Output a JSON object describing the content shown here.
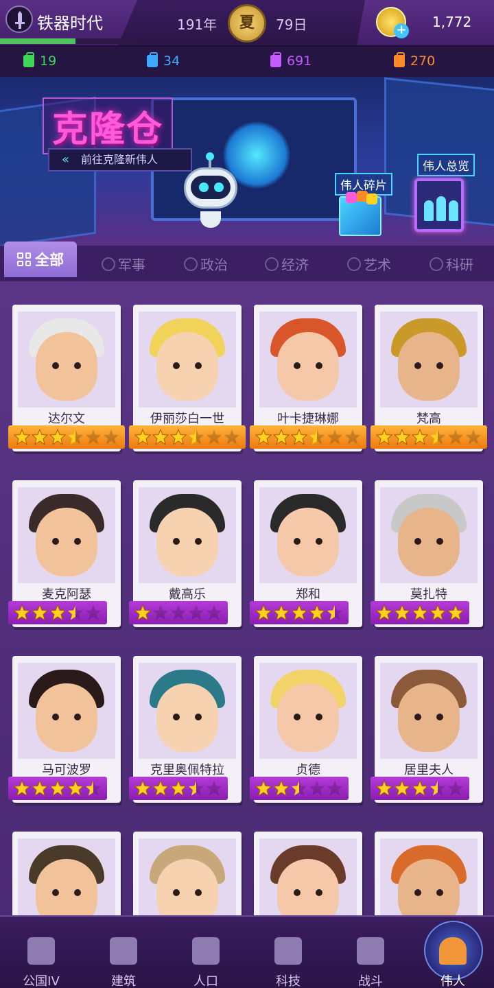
{
  "header": {
    "era_title": "铁器时代",
    "era_progress": 0.55,
    "year": "191年",
    "season": "夏",
    "day": "79日",
    "gold": "1,772"
  },
  "resources": [
    {
      "value": "19",
      "color": "#3fd65a",
      "icon": "green-bag-icon"
    },
    {
      "value": "34",
      "color": "#3fa8ff",
      "icon": "blue-bag-icon"
    },
    {
      "value": "691",
      "color": "#c55aff",
      "icon": "purple-bag-icon"
    },
    {
      "value": "270",
      "color": "#ff8a2a",
      "icon": "orange-bag-icon"
    }
  ],
  "banner": {
    "title": "克隆仓",
    "subtitle": "前往克隆新伟人",
    "fragments_label": "伟人碎片",
    "overview_label": "伟人总览"
  },
  "tabs": {
    "all": "全部",
    "military": "军事",
    "politics": "政治",
    "economy": "经济",
    "art": "艺术",
    "research": "科研"
  },
  "cards": [
    {
      "name": "达尔文",
      "stars": 3.5,
      "rarity": "orange"
    },
    {
      "name": "伊丽莎白一世",
      "stars": 3.5,
      "rarity": "orange"
    },
    {
      "name": "叶卡捷琳娜",
      "stars": 3.5,
      "rarity": "orange"
    },
    {
      "name": "梵高",
      "stars": 3.5,
      "rarity": "orange"
    },
    {
      "name": "麦克阿瑟",
      "stars": 3.5,
      "rarity": "purple"
    },
    {
      "name": "戴高乐",
      "stars": 1,
      "rarity": "purple"
    },
    {
      "name": "郑和",
      "stars": 4.5,
      "rarity": "purple"
    },
    {
      "name": "莫扎特",
      "stars": 5,
      "rarity": "purple"
    },
    {
      "name": "马可波罗",
      "stars": 4.5,
      "rarity": "purple"
    },
    {
      "name": "克里奥佩特拉",
      "stars": 3.5,
      "rarity": "purple"
    },
    {
      "name": "贞德",
      "stars": 2.5,
      "rarity": "purple"
    },
    {
      "name": "居里夫人",
      "stars": 3.5,
      "rarity": "purple"
    },
    {
      "name": "",
      "stars": 0,
      "rarity": "none"
    },
    {
      "name": "",
      "stars": 0,
      "rarity": "none"
    },
    {
      "name": "",
      "stars": 0,
      "rarity": "none"
    },
    {
      "name": "",
      "stars": 0,
      "rarity": "none"
    }
  ],
  "nav": [
    {
      "label": "公国IV",
      "icon": "castle-icon"
    },
    {
      "label": "建筑",
      "icon": "house-icon"
    },
    {
      "label": "人口",
      "icon": "person-icon"
    },
    {
      "label": "科技",
      "icon": "book-icon"
    },
    {
      "label": "战斗",
      "icon": "swords-icon"
    },
    {
      "label": "伟人",
      "icon": "statue-icon",
      "active": true
    }
  ],
  "colors": {
    "orange_star_bar": "#ec7a10",
    "purple_star_bar": "#8a1fb0",
    "star_gold": "#ffd21f"
  }
}
